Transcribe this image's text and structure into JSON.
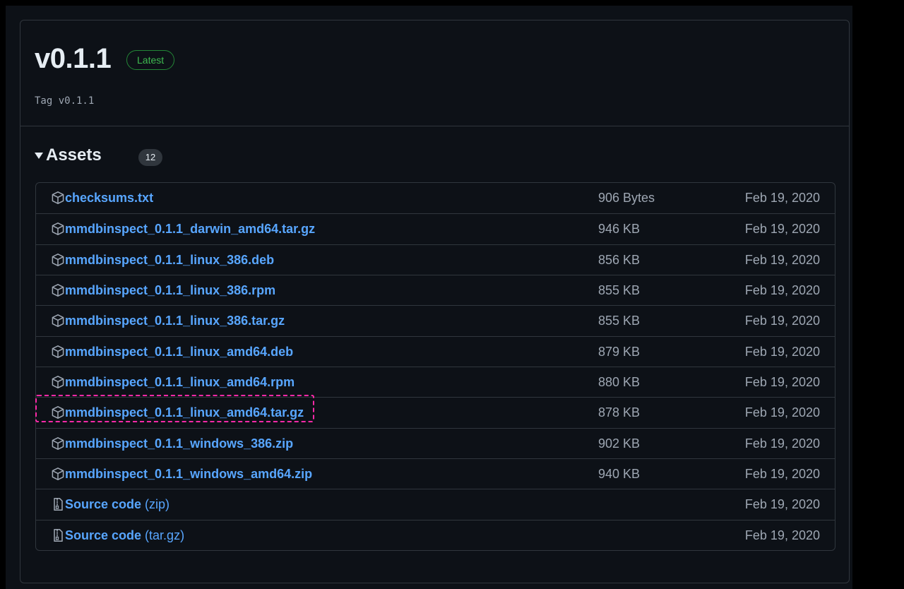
{
  "release": {
    "title": "v0.1.1",
    "badge": "Latest",
    "tag_line": "Tag v0.1.1"
  },
  "assets": {
    "title": "Assets",
    "count": "12",
    "items": [
      {
        "name": "checksums.txt",
        "suffix": "",
        "size": "906 Bytes",
        "date": "Feb 19, 2020",
        "icon": "package-icon"
      },
      {
        "name": "mmdbinspect_0.1.1_darwin_amd64.tar.gz",
        "suffix": "",
        "size": "946 KB",
        "date": "Feb 19, 2020",
        "icon": "package-icon"
      },
      {
        "name": "mmdbinspect_0.1.1_linux_386.deb",
        "suffix": "",
        "size": "856 KB",
        "date": "Feb 19, 2020",
        "icon": "package-icon"
      },
      {
        "name": "mmdbinspect_0.1.1_linux_386.rpm",
        "suffix": "",
        "size": "855 KB",
        "date": "Feb 19, 2020",
        "icon": "package-icon"
      },
      {
        "name": "mmdbinspect_0.1.1_linux_386.tar.gz",
        "suffix": "",
        "size": "855 KB",
        "date": "Feb 19, 2020",
        "icon": "package-icon"
      },
      {
        "name": "mmdbinspect_0.1.1_linux_amd64.deb",
        "suffix": "",
        "size": "879 KB",
        "date": "Feb 19, 2020",
        "icon": "package-icon"
      },
      {
        "name": "mmdbinspect_0.1.1_linux_amd64.rpm",
        "suffix": "",
        "size": "880 KB",
        "date": "Feb 19, 2020",
        "icon": "package-icon"
      },
      {
        "name": "mmdbinspect_0.1.1_linux_amd64.tar.gz",
        "suffix": "",
        "size": "878 KB",
        "date": "Feb 19, 2020",
        "icon": "package-icon"
      },
      {
        "name": "mmdbinspect_0.1.1_windows_386.zip",
        "suffix": "",
        "size": "902 KB",
        "date": "Feb 19, 2020",
        "icon": "package-icon"
      },
      {
        "name": "mmdbinspect_0.1.1_windows_amd64.zip",
        "suffix": "",
        "size": "940 KB",
        "date": "Feb 19, 2020",
        "icon": "package-icon"
      },
      {
        "name": "Source code",
        "suffix": " (zip)",
        "size": "",
        "date": "Feb 19, 2020",
        "icon": "file-zip-icon"
      },
      {
        "name": "Source code",
        "suffix": " (tar.gz)",
        "size": "",
        "date": "Feb 19, 2020",
        "icon": "file-zip-icon"
      }
    ]
  },
  "highlight": {
    "color": "#ff2aa8",
    "target": "mmdbinspect_0.1.1_linux_amd64.tar.gz"
  },
  "colors": {
    "link": "#58a6ff",
    "badge_green": "#3fb950",
    "background": "#0d1117",
    "border": "#30363d"
  }
}
